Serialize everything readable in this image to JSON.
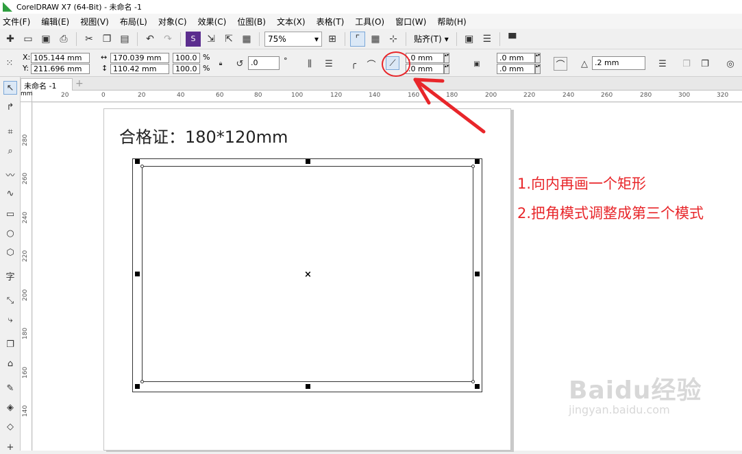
{
  "window": {
    "title": "CorelDRAW X7 (64-Bit) - 未命名 -1"
  },
  "menu": [
    "文件(F)",
    "编辑(E)",
    "视图(V)",
    "布局(L)",
    "对象(C)",
    "效果(C)",
    "位图(B)",
    "文本(X)",
    "表格(T)",
    "工具(O)",
    "窗口(W)",
    "帮助(H)"
  ],
  "toolbar": {
    "zoom": "75%",
    "snap_label": "贴齐(T)"
  },
  "property_bar": {
    "x_label": "X:",
    "x_value": "105.144 mm",
    "y_label": "Y:",
    "y_value": "211.696 mm",
    "width_value": "170.039 mm",
    "height_value": "110.42 mm",
    "scale_w": "100.0",
    "scale_h": "100.0",
    "percent": "%",
    "rotation": ".0",
    "degree": "°",
    "corner1": ".0 mm",
    "corner2": ".0 mm",
    "corner3": ".0 mm",
    "corner4": ".0 mm",
    "outline_width": ".2 mm"
  },
  "document": {
    "tab_label": "未命名 -1"
  },
  "ruler": {
    "h_ticks": [
      "20",
      "0",
      "20",
      "40",
      "60",
      "80",
      "100",
      "120",
      "140",
      "160",
      "180",
      "200",
      "220",
      "240",
      "260",
      "280",
      "300",
      "320"
    ],
    "v_ticks": [
      "280",
      "260",
      "240",
      "220",
      "200",
      "180",
      "160",
      "140"
    ],
    "corner": "mm"
  },
  "canvas": {
    "title_text": "合格证：180*120mm"
  },
  "annotations": {
    "step1": "1.向内再画一个矩形",
    "step2": "2.把角模式调整成第三个模式"
  },
  "watermark": {
    "main": "Baidu经验",
    "sub": "jingyan.baidu.com"
  },
  "colors": {
    "annotation_red": "#e8262a",
    "logo_green": "#2e9e3f"
  }
}
